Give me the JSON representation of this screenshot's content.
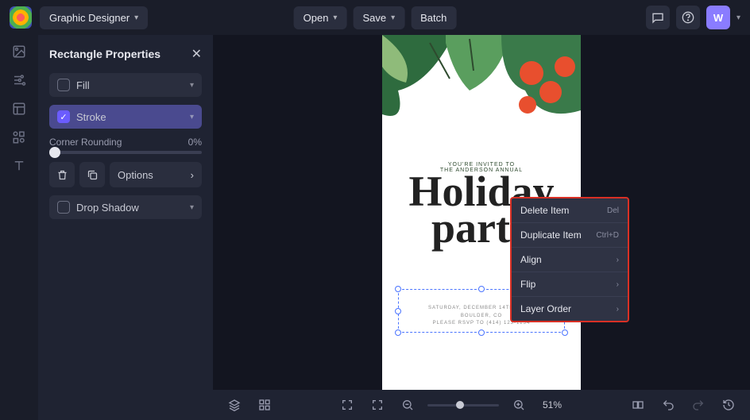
{
  "header": {
    "mode": "Graphic Designer",
    "open": "Open",
    "save": "Save",
    "batch": "Batch",
    "avatar_letter": "W"
  },
  "panel": {
    "title": "Rectangle Properties",
    "fill": "Fill",
    "stroke": "Stroke",
    "corner_rounding_label": "Corner Rounding",
    "corner_rounding_value": "0%",
    "options": "Options",
    "drop_shadow": "Drop Shadow"
  },
  "canvas": {
    "invited_line": "YOU'RE INVITED TO",
    "annual_line": "THE ANDERSON ANNUAL",
    "holiday": "Holiday",
    "party": "party",
    "details_date": "SATURDAY, DECEMBER 14TH · 6 PM",
    "details_location": "BOULDER, CO",
    "details_rsvp": "PLEASE RSVP TO (414) 123-1234"
  },
  "context_menu": {
    "delete": "Delete Item",
    "delete_key": "Del",
    "duplicate": "Duplicate Item",
    "duplicate_key": "Ctrl+D",
    "align": "Align",
    "flip": "Flip",
    "layer_order": "Layer Order"
  },
  "bottombar": {
    "zoom": "51%"
  }
}
